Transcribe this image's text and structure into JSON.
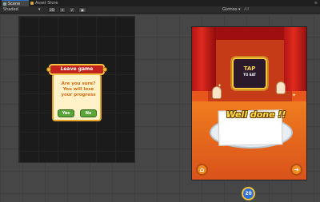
{
  "tabs": [
    {
      "label": "Scene",
      "icon": "scene-icon",
      "active": true
    },
    {
      "label": "Asset Store",
      "icon": "asset-store-icon",
      "active": false
    }
  ],
  "toolbar": {
    "shading_mode": "Shaded",
    "mode_2d": "2D",
    "gizmos_label": "Gizmos",
    "search_placeholder": "All"
  },
  "leave_dialog": {
    "title": "Leave game",
    "message": "Are you sure? You will lose your progress",
    "yes_label": "Yes",
    "no_label": "No"
  },
  "game_screen": {
    "sign_title": "TAP",
    "sign_subtitle": "TO EAT",
    "banner": "Well done !!",
    "home_icon": "home-icon",
    "next_icon": "arrow-right-icon",
    "colors": {
      "accent": "#e7561a",
      "curtain": "#c01818",
      "gold": "#f7c53d"
    }
  },
  "timer_badge": {
    "value": "20"
  }
}
